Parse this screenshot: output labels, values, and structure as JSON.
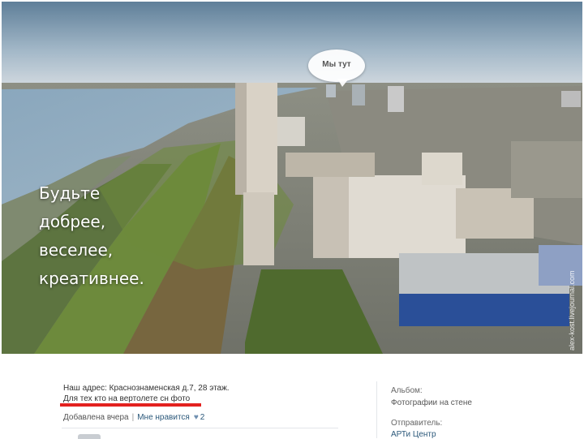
{
  "photo": {
    "slogan_lines": [
      "Будьте",
      "добрее,",
      "веселее,",
      "креативнее."
    ],
    "bubble_label": "Мы тут",
    "watermark": "alex-kost.livejournal.com"
  },
  "info": {
    "address": "Наш адрес: Краснознаменская д.7, 28 этаж.",
    "photo_note": "Для тех кто на вертолете сн фото",
    "added": "Добавлена вчера",
    "like_label": "Мне нравится",
    "like_count": "2"
  },
  "sidebar": {
    "album_label": "Альбом:",
    "album_value": "Фотографии на стене",
    "sender_label": "Отправитель:",
    "sender_value": "АРТи Центр"
  },
  "colors": {
    "accent_red": "#e3211f",
    "link_blue": "#2b587a"
  },
  "icons": {
    "like": "heart-icon"
  }
}
